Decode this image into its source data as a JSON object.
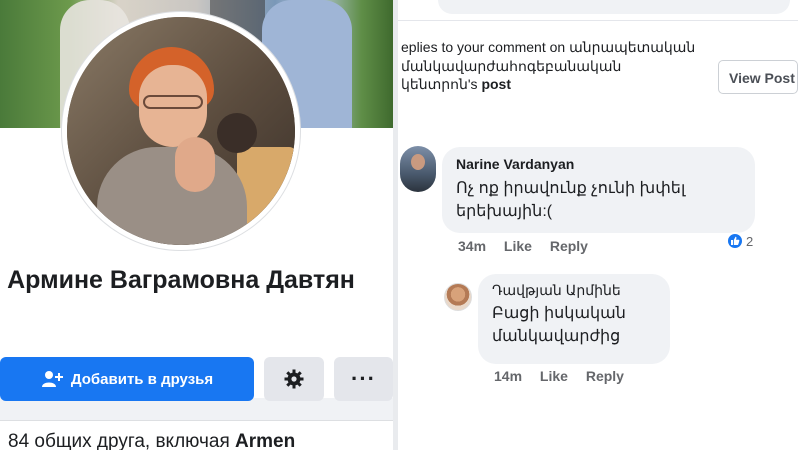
{
  "profile": {
    "name": "Армине Ваграмовна Давтян",
    "add_friend_label": "Добавить в друзья",
    "more_label": "···",
    "mutual_text": "84 общих друга, включая ",
    "mutual_name": "Armen"
  },
  "notification": {
    "text": "eplies to your comment on ",
    "page_name": "անրապետական մանկավարժահոգեբանական կենտրոն",
    "suffix": "'s ",
    "post_word": "post",
    "view_label": "View Post"
  },
  "comments": [
    {
      "author": "Narine Vardanyan",
      "text": "Ոչ ոք իրավունք չունի խփել երեխային:(",
      "time": "34m",
      "like": "Like",
      "reply": "Reply",
      "reactions_count": "2"
    },
    {
      "author": "Դավթյան Արմինե",
      "text": "Բացի իսկական մանկավարժից",
      "time": "14m",
      "like": "Like",
      "reply": "Reply"
    }
  ],
  "colors": {
    "primary": "#1877f2",
    "bubble": "#f0f2f5",
    "meta": "#65676b"
  }
}
